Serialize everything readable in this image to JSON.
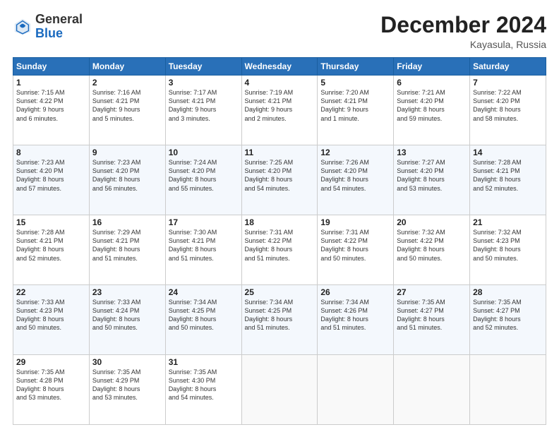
{
  "logo": {
    "text_general": "General",
    "text_blue": "Blue"
  },
  "header": {
    "month_title": "December 2024",
    "location": "Kayasula, Russia"
  },
  "days_of_week": [
    "Sunday",
    "Monday",
    "Tuesday",
    "Wednesday",
    "Thursday",
    "Friday",
    "Saturday"
  ],
  "weeks": [
    [
      {
        "day": "1",
        "lines": [
          "Sunrise: 7:15 AM",
          "Sunset: 4:22 PM",
          "Daylight: 9 hours",
          "and 6 minutes."
        ]
      },
      {
        "day": "2",
        "lines": [
          "Sunrise: 7:16 AM",
          "Sunset: 4:21 PM",
          "Daylight: 9 hours",
          "and 5 minutes."
        ]
      },
      {
        "day": "3",
        "lines": [
          "Sunrise: 7:17 AM",
          "Sunset: 4:21 PM",
          "Daylight: 9 hours",
          "and 3 minutes."
        ]
      },
      {
        "day": "4",
        "lines": [
          "Sunrise: 7:19 AM",
          "Sunset: 4:21 PM",
          "Daylight: 9 hours",
          "and 2 minutes."
        ]
      },
      {
        "day": "5",
        "lines": [
          "Sunrise: 7:20 AM",
          "Sunset: 4:21 PM",
          "Daylight: 9 hours",
          "and 1 minute."
        ]
      },
      {
        "day": "6",
        "lines": [
          "Sunrise: 7:21 AM",
          "Sunset: 4:20 PM",
          "Daylight: 8 hours",
          "and 59 minutes."
        ]
      },
      {
        "day": "7",
        "lines": [
          "Sunrise: 7:22 AM",
          "Sunset: 4:20 PM",
          "Daylight: 8 hours",
          "and 58 minutes."
        ]
      }
    ],
    [
      {
        "day": "8",
        "lines": [
          "Sunrise: 7:23 AM",
          "Sunset: 4:20 PM",
          "Daylight: 8 hours",
          "and 57 minutes."
        ]
      },
      {
        "day": "9",
        "lines": [
          "Sunrise: 7:23 AM",
          "Sunset: 4:20 PM",
          "Daylight: 8 hours",
          "and 56 minutes."
        ]
      },
      {
        "day": "10",
        "lines": [
          "Sunrise: 7:24 AM",
          "Sunset: 4:20 PM",
          "Daylight: 8 hours",
          "and 55 minutes."
        ]
      },
      {
        "day": "11",
        "lines": [
          "Sunrise: 7:25 AM",
          "Sunset: 4:20 PM",
          "Daylight: 8 hours",
          "and 54 minutes."
        ]
      },
      {
        "day": "12",
        "lines": [
          "Sunrise: 7:26 AM",
          "Sunset: 4:20 PM",
          "Daylight: 8 hours",
          "and 54 minutes."
        ]
      },
      {
        "day": "13",
        "lines": [
          "Sunrise: 7:27 AM",
          "Sunset: 4:20 PM",
          "Daylight: 8 hours",
          "and 53 minutes."
        ]
      },
      {
        "day": "14",
        "lines": [
          "Sunrise: 7:28 AM",
          "Sunset: 4:21 PM",
          "Daylight: 8 hours",
          "and 52 minutes."
        ]
      }
    ],
    [
      {
        "day": "15",
        "lines": [
          "Sunrise: 7:28 AM",
          "Sunset: 4:21 PM",
          "Daylight: 8 hours",
          "and 52 minutes."
        ]
      },
      {
        "day": "16",
        "lines": [
          "Sunrise: 7:29 AM",
          "Sunset: 4:21 PM",
          "Daylight: 8 hours",
          "and 51 minutes."
        ]
      },
      {
        "day": "17",
        "lines": [
          "Sunrise: 7:30 AM",
          "Sunset: 4:21 PM",
          "Daylight: 8 hours",
          "and 51 minutes."
        ]
      },
      {
        "day": "18",
        "lines": [
          "Sunrise: 7:31 AM",
          "Sunset: 4:22 PM",
          "Daylight: 8 hours",
          "and 51 minutes."
        ]
      },
      {
        "day": "19",
        "lines": [
          "Sunrise: 7:31 AM",
          "Sunset: 4:22 PM",
          "Daylight: 8 hours",
          "and 50 minutes."
        ]
      },
      {
        "day": "20",
        "lines": [
          "Sunrise: 7:32 AM",
          "Sunset: 4:22 PM",
          "Daylight: 8 hours",
          "and 50 minutes."
        ]
      },
      {
        "day": "21",
        "lines": [
          "Sunrise: 7:32 AM",
          "Sunset: 4:23 PM",
          "Daylight: 8 hours",
          "and 50 minutes."
        ]
      }
    ],
    [
      {
        "day": "22",
        "lines": [
          "Sunrise: 7:33 AM",
          "Sunset: 4:23 PM",
          "Daylight: 8 hours",
          "and 50 minutes."
        ]
      },
      {
        "day": "23",
        "lines": [
          "Sunrise: 7:33 AM",
          "Sunset: 4:24 PM",
          "Daylight: 8 hours",
          "and 50 minutes."
        ]
      },
      {
        "day": "24",
        "lines": [
          "Sunrise: 7:34 AM",
          "Sunset: 4:25 PM",
          "Daylight: 8 hours",
          "and 50 minutes."
        ]
      },
      {
        "day": "25",
        "lines": [
          "Sunrise: 7:34 AM",
          "Sunset: 4:25 PM",
          "Daylight: 8 hours",
          "and 51 minutes."
        ]
      },
      {
        "day": "26",
        "lines": [
          "Sunrise: 7:34 AM",
          "Sunset: 4:26 PM",
          "Daylight: 8 hours",
          "and 51 minutes."
        ]
      },
      {
        "day": "27",
        "lines": [
          "Sunrise: 7:35 AM",
          "Sunset: 4:27 PM",
          "Daylight: 8 hours",
          "and 51 minutes."
        ]
      },
      {
        "day": "28",
        "lines": [
          "Sunrise: 7:35 AM",
          "Sunset: 4:27 PM",
          "Daylight: 8 hours",
          "and 52 minutes."
        ]
      }
    ],
    [
      {
        "day": "29",
        "lines": [
          "Sunrise: 7:35 AM",
          "Sunset: 4:28 PM",
          "Daylight: 8 hours",
          "and 53 minutes."
        ]
      },
      {
        "day": "30",
        "lines": [
          "Sunrise: 7:35 AM",
          "Sunset: 4:29 PM",
          "Daylight: 8 hours",
          "and 53 minutes."
        ]
      },
      {
        "day": "31",
        "lines": [
          "Sunrise: 7:35 AM",
          "Sunset: 4:30 PM",
          "Daylight: 8 hours",
          "and 54 minutes."
        ]
      },
      null,
      null,
      null,
      null
    ]
  ]
}
